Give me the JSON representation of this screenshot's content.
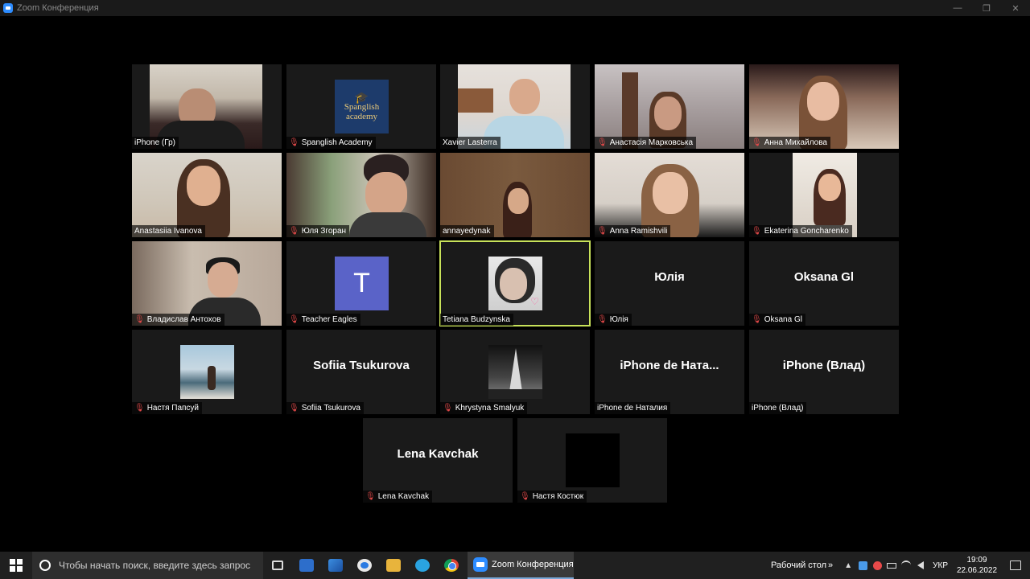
{
  "window": {
    "title": "Zoom Конференция",
    "controls": [
      "—",
      "❐",
      "✕"
    ]
  },
  "participants": [
    {
      "name": "iPhone (Гр)",
      "muted": false,
      "kind": "video",
      "scene": "1"
    },
    {
      "name": "Spanglish Academy",
      "muted": true,
      "kind": "logo",
      "logo_line1": "Spanglish",
      "logo_line2": "academy"
    },
    {
      "name": "Xavier Lasterra",
      "muted": false,
      "kind": "video",
      "scene": "3"
    },
    {
      "name": "Анастасія Марковська",
      "muted": true,
      "kind": "video",
      "scene": "4"
    },
    {
      "name": "Анна Михайлова",
      "muted": true,
      "kind": "video",
      "scene": "5"
    },
    {
      "name": "Anastasiia Ivanova",
      "muted": false,
      "kind": "video",
      "scene": "6"
    },
    {
      "name": "Юля Згоран",
      "muted": true,
      "kind": "video",
      "scene": "7"
    },
    {
      "name": "annayedynak",
      "muted": false,
      "kind": "video",
      "scene": "8"
    },
    {
      "name": "Anna Ramishvili",
      "muted": true,
      "kind": "video",
      "scene": "9"
    },
    {
      "name": "Ekaterina Goncharenko",
      "muted": true,
      "kind": "video",
      "scene": "10"
    },
    {
      "name": "Владислав Антохов",
      "muted": true,
      "kind": "video",
      "scene": "11"
    },
    {
      "name": "Teacher Eagles",
      "muted": true,
      "kind": "letter",
      "letter": "T"
    },
    {
      "name": "Tetiana Budzynska",
      "muted": false,
      "kind": "portrait",
      "speaking": true
    },
    {
      "name": "Юлія",
      "muted": true,
      "kind": "text",
      "display_name": "Юлія"
    },
    {
      "name": "Oksana Gl",
      "muted": true,
      "kind": "text",
      "display_name": "Oksana Gl"
    },
    {
      "name": "Настя Папсуй",
      "muted": true,
      "kind": "beach"
    },
    {
      "name": "Sofiia Tsukurova",
      "muted": true,
      "kind": "text",
      "display_name": "Sofiia Tsukurova"
    },
    {
      "name": "Khrystyna Smalyuk",
      "muted": true,
      "kind": "paris"
    },
    {
      "name": "iPhone de Наталия",
      "muted": false,
      "kind": "text",
      "display_name": "iPhone de Ната..."
    },
    {
      "name": "iPhone (Влад)",
      "muted": false,
      "kind": "text",
      "display_name": "iPhone (Влад)"
    },
    {
      "name": "Lena Kavchak",
      "muted": true,
      "kind": "text",
      "display_name": "Lena Kavchak"
    },
    {
      "name": "Настя Костюк",
      "muted": true,
      "kind": "black"
    }
  ],
  "taskbar": {
    "search_placeholder": "Чтобы начать поиск, введите здесь запрос",
    "zoom_label": "Zoom Конференция",
    "desktop_label": "Рабочий стол",
    "chevron": "»",
    "tray_up": "▲",
    "language": "УКР",
    "time": "19:09",
    "date": "22.06.2022"
  },
  "colors": {
    "tile_bg": "#1a1a1a",
    "active_speaker": "#c8e25a",
    "muted_icon": "#e04848",
    "taskbar": "#202020"
  }
}
